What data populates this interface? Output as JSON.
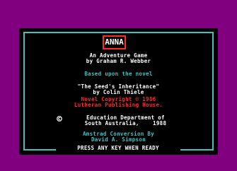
{
  "colors": {
    "border": "#800080",
    "paper": "#000000",
    "frame": "#40c0c0",
    "white": "#ffffff",
    "cyan": "#40c0c0",
    "red": "#ff2a2a"
  },
  "title": "ANNA",
  "credits": {
    "line1": "An Adventure Game",
    "line2": "by Graham R. Webber",
    "line3": "Based upon the novel",
    "line4": "\"The Seed's Inheritance\"",
    "line5": "by Colin Thiele",
    "line6": "Novel Copyright © 1986",
    "line7": "Lutheran Publishing House.",
    "line8": "Education Department of",
    "line9": "South Australia,    1988",
    "line10": "Amstrad Conversion By",
    "line11": "David A. Simpson"
  },
  "prompt": "PRESS ANY KEY WHEN READY",
  "icons": {
    "copyright": "copyright-icon"
  }
}
